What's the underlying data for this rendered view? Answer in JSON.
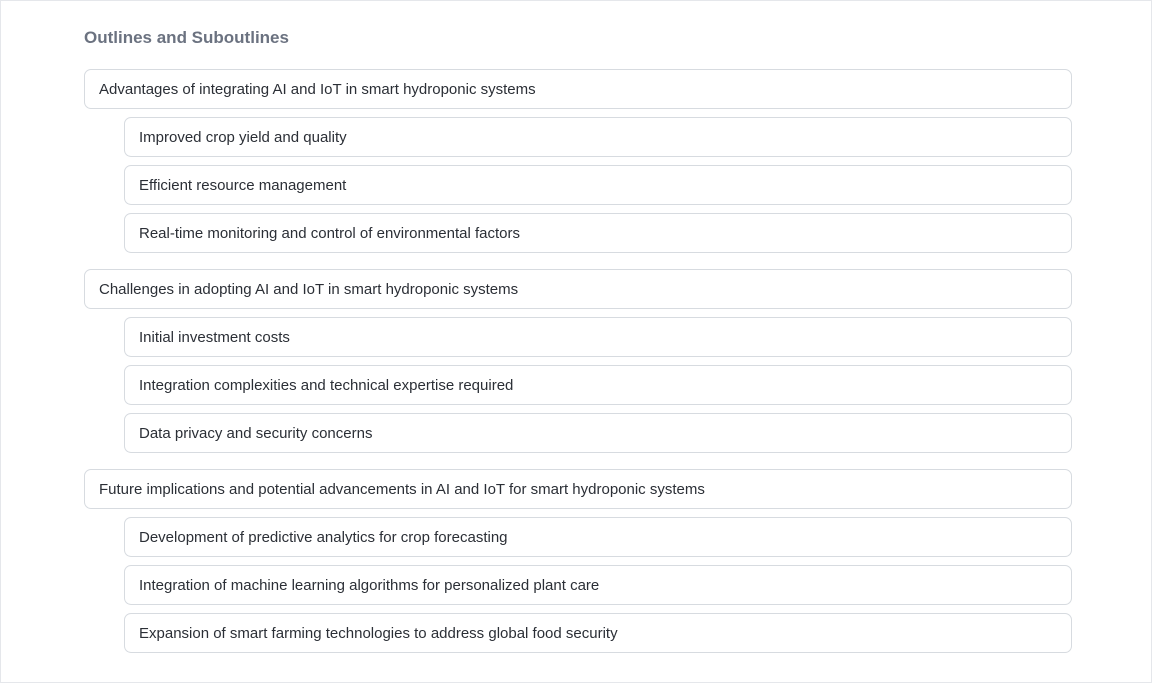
{
  "section": {
    "title": "Outlines and Suboutlines"
  },
  "outlines": [
    {
      "title": "Advantages of integrating AI and IoT in smart hydroponic systems",
      "subs": [
        "Improved crop yield and quality",
        "Efficient resource management",
        "Real-time monitoring and control of environmental factors"
      ]
    },
    {
      "title": "Challenges in adopting AI and IoT in smart hydroponic systems",
      "subs": [
        "Initial investment costs",
        "Integration complexities and technical expertise required",
        "Data privacy and security concerns"
      ]
    },
    {
      "title": "Future implications and potential advancements in AI and IoT for smart hydroponic systems",
      "subs": [
        "Development of predictive analytics for crop forecasting",
        "Integration of machine learning algorithms for personalized plant care",
        "Expansion of smart farming technologies to address global food security"
      ]
    }
  ]
}
